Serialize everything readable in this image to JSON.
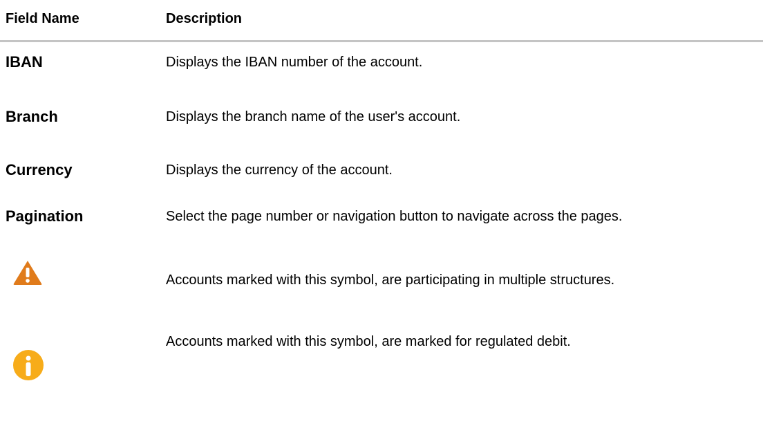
{
  "table": {
    "headers": {
      "field_name": "Field Name",
      "description": "Description"
    },
    "rows": [
      {
        "field": "IBAN",
        "description": "Displays the IBAN number of the account."
      },
      {
        "field": "Branch",
        "description": "Displays the branch name of the user's account."
      },
      {
        "field": "Currency",
        "description": "Displays the currency of the account."
      },
      {
        "field": "Pagination",
        "description": "Select the page number or navigation button to navigate across the pages."
      },
      {
        "icon": "warning-icon",
        "icon_color": "#e07b1b",
        "description": "Accounts marked with this symbol, are participating in multiple structures."
      },
      {
        "icon": "info-icon",
        "icon_color": "#f7ac1a",
        "description": "Accounts marked with this symbol, are marked for regulated debit."
      }
    ]
  }
}
